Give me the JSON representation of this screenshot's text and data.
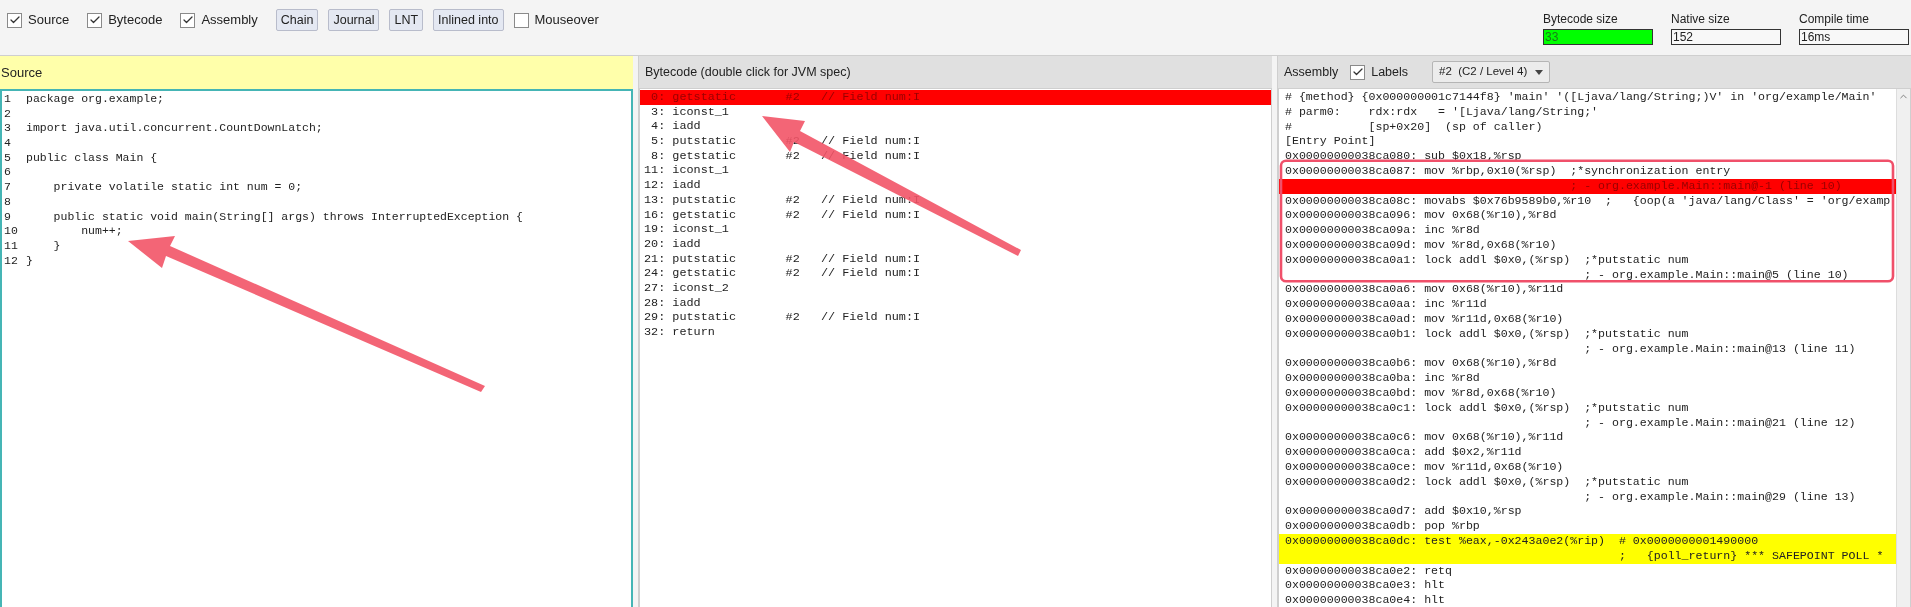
{
  "toolbar": {
    "items": [
      {
        "kind": "checkbox",
        "label": "Source",
        "checked": true
      },
      {
        "kind": "checkbox",
        "label": "Bytecode",
        "checked": true
      },
      {
        "kind": "checkbox",
        "label": "Assembly",
        "checked": true
      },
      {
        "kind": "button",
        "label": "Chain"
      },
      {
        "kind": "button",
        "label": "Journal"
      },
      {
        "kind": "button",
        "label": "LNT"
      },
      {
        "kind": "button",
        "label": "Inlined into"
      },
      {
        "kind": "checkbox",
        "label": "Mouseover",
        "checked": false
      }
    ],
    "stats": [
      {
        "label": "Bytecode size",
        "value": "33",
        "highlighted": true
      },
      {
        "label": "Native size",
        "value": "152",
        "highlighted": false
      },
      {
        "label": "Compile time",
        "value": "16ms",
        "highlighted": false
      }
    ]
  },
  "source": {
    "title": "Source",
    "lines": [
      {
        "number": "1",
        "text": "package org.example;"
      },
      {
        "number": "2"
      },
      {
        "number": "3",
        "text": "import java.util.concurrent.CountDownLatch;"
      },
      {
        "number": "4"
      },
      {
        "number": "5",
        "text": "public class Main {"
      },
      {
        "number": "6"
      },
      {
        "number": "7",
        "text": "    private volatile static int num = 0;"
      },
      {
        "number": "8"
      },
      {
        "number": "9",
        "text": "    public static void main(String[] args) throws InterruptedException {"
      },
      {
        "number": "10",
        "text": "        num++;"
      },
      {
        "number": "11",
        "text": "    }"
      },
      {
        "number": "12",
        "text": "}"
      }
    ]
  },
  "bytecode": {
    "title": "Bytecode (double click for JVM spec)",
    "rows": [
      {
        "text": " 0: getstatic       #2   // Field num:I",
        "selected": true
      },
      {
        "text": " 3: iconst_1",
        "selected": false
      },
      {
        "text": " 4: iadd",
        "selected": false
      },
      {
        "text": " 5: putstatic       #2   // Field num:I",
        "selected": false
      },
      {
        "text": " 8: getstatic       #2   // Field num:I",
        "selected": false
      },
      {
        "text": "11: iconst_1",
        "selected": false
      },
      {
        "text": "12: iadd",
        "selected": false
      },
      {
        "text": "13: putstatic       #2   // Field num:I",
        "selected": false
      },
      {
        "text": "16: getstatic       #2   // Field num:I",
        "selected": false
      },
      {
        "text": "19: iconst_1",
        "selected": false
      },
      {
        "text": "20: iadd",
        "selected": false
      },
      {
        "text": "21: putstatic       #2   // Field num:I",
        "selected": false
      },
      {
        "text": "24: getstatic       #2   // Field num:I",
        "selected": false
      },
      {
        "text": "27: iconst_2",
        "selected": false
      },
      {
        "text": "28: iadd",
        "selected": false
      },
      {
        "text": "29: putstatic       #2   // Field num:I",
        "selected": false
      },
      {
        "text": "32: return",
        "selected": false
      }
    ]
  },
  "assembly": {
    "title": "Assembly",
    "labels": {
      "label": "Labels",
      "checked": true
    },
    "compilation": "#2  (C2 / Level 4)",
    "rows": [
      {
        "text": "# {method} {0x000000001c7144f8} 'main' '([Ljava/lang/String;)V' in 'org/example/Main'",
        "selected": false
      },
      {
        "text": "# parm0:    rdx:rdx   = '[Ljava/lang/String;'",
        "selected": false
      },
      {
        "text": "#           [sp+0x20]  (sp of caller)",
        "selected": false
      },
      {
        "text": "[Entry Point]",
        "selected": false
      },
      {
        "text": "0x00000000038ca080: sub $0x18,%rsp",
        "selected": false
      },
      {
        "text": "0x00000000038ca087: mov %rbp,0x10(%rsp)  ;*synchronization entry",
        "selected": false
      },
      {
        "text": "                                         ; - org.example.Main::main@-1 (line 10)",
        "selected": true
      },
      {
        "text": "0x00000000038ca08c: movabs $0x76b9589b0,%r10  ;   {oop(a 'java/lang/Class' = 'org/examp",
        "selected": false
      },
      {
        "text": "0x00000000038ca096: mov 0x68(%r10),%r8d",
        "selected": false
      },
      {
        "text": "0x00000000038ca09a: inc %r8d",
        "selected": false
      },
      {
        "text": "0x00000000038ca09d: mov %r8d,0x68(%r10)",
        "selected": false
      },
      {
        "text": "0x00000000038ca0a1: lock addl $0x0,(%rsp)  ;*putstatic num",
        "selected": false
      },
      {
        "text": "                                           ; - org.example.Main::main@5 (line 10)",
        "selected": false
      },
      {
        "text": "0x00000000038ca0a6: mov 0x68(%r10),%r11d",
        "selected": false
      },
      {
        "text": "0x00000000038ca0aa: inc %r11d",
        "selected": false
      },
      {
        "text": "0x00000000038ca0ad: mov %r11d,0x68(%r10)",
        "selected": false
      },
      {
        "text": "0x00000000038ca0b1: lock addl $0x0,(%rsp)  ;*putstatic num",
        "selected": false
      },
      {
        "text": "                                           ; - org.example.Main::main@13 (line 11)",
        "selected": false
      },
      {
        "text": "0x00000000038ca0b6: mov 0x68(%r10),%r8d",
        "selected": false
      },
      {
        "text": "0x00000000038ca0ba: inc %r8d",
        "selected": false
      },
      {
        "text": "0x00000000038ca0bd: mov %r8d,0x68(%r10)",
        "selected": false
      },
      {
        "text": "0x00000000038ca0c1: lock addl $0x0,(%rsp)  ;*putstatic num",
        "selected": false
      },
      {
        "text": "                                           ; - org.example.Main::main@21 (line 12)",
        "selected": false
      },
      {
        "text": "0x00000000038ca0c6: mov 0x68(%r10),%r11d",
        "selected": false
      },
      {
        "text": "0x00000000038ca0ca: add $0x2,%r11d",
        "selected": false
      },
      {
        "text": "0x00000000038ca0ce: mov %r11d,0x68(%r10)",
        "selected": false
      },
      {
        "text": "0x00000000038ca0d2: lock addl $0x0,(%rsp)  ;*putstatic num",
        "selected": false
      },
      {
        "text": "                                           ; - org.example.Main::main@29 (line 13)",
        "selected": false
      },
      {
        "text": "0x00000000038ca0d7: add $0x10,%rsp",
        "selected": false
      },
      {
        "text": "0x00000000038ca0db: pop %rbp",
        "selected": false
      },
      {
        "text": "0x00000000038ca0dc: test %eax,-0x243a0e2(%rip)  # 0x0000000001490000",
        "selected": false,
        "color": "#ffff00"
      },
      {
        "text": "                                                ;   {poll_return} *** SAFEPOINT POLL *",
        "selected": false,
        "color": "#ffff00"
      },
      {
        "text": "0x00000000038ca0e2: retq",
        "selected": false
      },
      {
        "text": "0x00000000038ca0e3: hlt",
        "selected": false
      },
      {
        "text": "0x00000000038ca0e4: hlt",
        "selected": false
      }
    ]
  }
}
